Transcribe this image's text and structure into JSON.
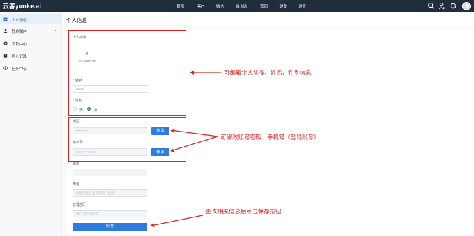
{
  "topbar": {
    "logo": "云客yunke.ai",
    "nav": [
      "首页",
      "客户",
      "微信",
      "微小助",
      "营销",
      "设备",
      "设置"
    ]
  },
  "sidebar": {
    "items": [
      {
        "label": "个人信息",
        "icon": "profile-icon",
        "active": true
      },
      {
        "label": "我的账户",
        "icon": "user-icon",
        "active": false,
        "caret": "⌄"
      },
      {
        "label": "下载中心",
        "icon": "download-icon",
        "active": false
      },
      {
        "label": "导入记录",
        "icon": "import-icon",
        "active": false
      },
      {
        "label": "任务中心",
        "icon": "task-icon",
        "active": false
      }
    ]
  },
  "page": {
    "title": "个人信息"
  },
  "form": {
    "avatar_label": "个人头像",
    "avatar_plus": "+",
    "avatar_hint": "点击可更换头像",
    "name_label": "姓名",
    "name_value": "Anna",
    "gender_label": "性别",
    "gender_male": "男",
    "gender_female": "女",
    "gender_selected": "女",
    "password_label": "密码",
    "password_value": "••••••••••",
    "modify_label": "修 改",
    "phone_label": "手机号",
    "phone_value": "188 **** 4028",
    "email_label": "邮箱",
    "email_value": "",
    "role_label": "角色",
    "role_value": "超级管理员·全部权限（展示）",
    "dept_label": "管理部门",
    "dept_value": "部门:天下鱼信息",
    "required_mark": "*",
    "save_label": "保 存"
  },
  "annotations": {
    "edit_profile": "可编辑个人头像、姓名、性别信息",
    "edit_account": "可修改账号密码、手机号（登陆账号）",
    "save_hint": "更改相关信息后点击保存按钮",
    "color": "#e02020"
  },
  "colors": {
    "topbar": "#1f2d3d",
    "accent": "#2f7be0",
    "sidebar_active": "#e6effa"
  }
}
